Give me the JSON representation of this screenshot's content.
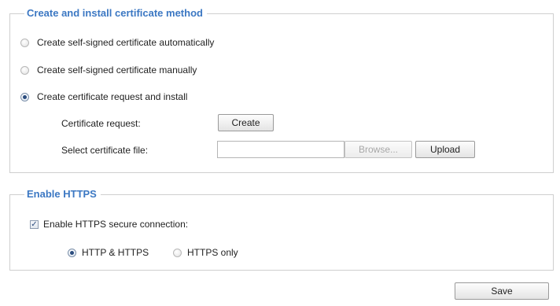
{
  "cert_section": {
    "legend": "Create and install certificate method",
    "options": [
      {
        "label": "Create self-signed certificate automatically",
        "checked": false
      },
      {
        "label": "Create self-signed certificate manually",
        "checked": false
      },
      {
        "label": "Create certificate request and install",
        "checked": true
      }
    ],
    "request_label": "Certificate request:",
    "create_button": "Create",
    "select_label": "Select certificate file:",
    "file_value": "",
    "browse_button": "Browse...",
    "upload_button": "Upload"
  },
  "https_section": {
    "legend": "Enable HTTPS",
    "enable_label": "Enable HTTPS secure connection:",
    "enable_checked": true,
    "modes": [
      {
        "label": "HTTP & HTTPS",
        "checked": true
      },
      {
        "label": "HTTPS only",
        "checked": false
      }
    ]
  },
  "save_button": "Save"
}
